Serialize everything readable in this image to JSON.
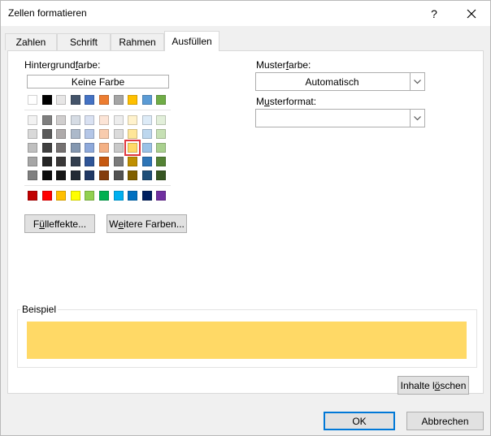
{
  "window": {
    "title": "Zellen formatieren",
    "help_glyph": "?",
    "close_icon": "close-icon"
  },
  "tabs": [
    {
      "label": "Zahlen",
      "active": false
    },
    {
      "label": "Schrift",
      "active": false
    },
    {
      "label": "Rahmen",
      "active": false
    },
    {
      "label": "Ausfüllen",
      "active": true
    }
  ],
  "background": {
    "label": "Hintergrundfarbe:",
    "label_pre": "Hintergrund",
    "label_ul": "f",
    "label_post": "arbe:",
    "no_color_label": "Keine Farbe",
    "selected_color": "#ffd966",
    "theme_top_row": [
      "#ffffff",
      "#000000",
      "#e7e6e6",
      "#44546a",
      "#4472c4",
      "#ed7d31",
      "#a5a5a5",
      "#ffc000",
      "#5b9bd5",
      "#70ad47"
    ],
    "theme_shades": [
      [
        "#f2f2f2",
        "#7f7f7f",
        "#d0cece",
        "#d6dce4",
        "#d9e1f2",
        "#fce4d6",
        "#ededed",
        "#fff2cc",
        "#ddebf7",
        "#e2efda"
      ],
      [
        "#d9d9d9",
        "#595959",
        "#aeaaaa",
        "#acb9ca",
        "#b4c6e7",
        "#f8cbad",
        "#dbdbdb",
        "#ffe699",
        "#bdd7ee",
        "#c6e0b4"
      ],
      [
        "#bfbfbf",
        "#404040",
        "#757171",
        "#8497b0",
        "#8ea9db",
        "#f4b084",
        "#c9c9c9",
        "#ffd966",
        "#9bc2e6",
        "#a9d08e"
      ],
      [
        "#a6a6a6",
        "#262626",
        "#3a3838",
        "#333f4f",
        "#2f5597",
        "#c65911",
        "#7b7b7b",
        "#bf8f00",
        "#2e75b6",
        "#548235"
      ],
      [
        "#808080",
        "#0d0d0d",
        "#161616",
        "#222b35",
        "#203864",
        "#843c0c",
        "#525252",
        "#806000",
        "#1f4e78",
        "#375623"
      ]
    ],
    "standard_row": [
      "#c00000",
      "#ff0000",
      "#ffc000",
      "#ffff00",
      "#92d050",
      "#00b050",
      "#00b0f0",
      "#0070c0",
      "#002060",
      "#7030a0"
    ],
    "fill_effects_label_pre": "F",
    "fill_effects_label_ul": "ü",
    "fill_effects_label_post": "lleffekte...",
    "more_colors_label_pre": "W",
    "more_colors_label_ul": "e",
    "more_colors_label_post": "itere Farben..."
  },
  "pattern": {
    "color_label_pre": "Muster",
    "color_label_ul": "f",
    "color_label_post": "arbe:",
    "color_value": "Automatisch",
    "format_label_pre": "M",
    "format_label_ul": "u",
    "format_label_post": "sterformat:",
    "format_value": ""
  },
  "sample": {
    "label": "Beispiel",
    "color": "#ffd966"
  },
  "clear_button": {
    "pre": "Inhalte l",
    "ul": "ö",
    "post": "schen"
  },
  "footer": {
    "ok_label": "OK",
    "cancel_label": "Abbrechen"
  }
}
